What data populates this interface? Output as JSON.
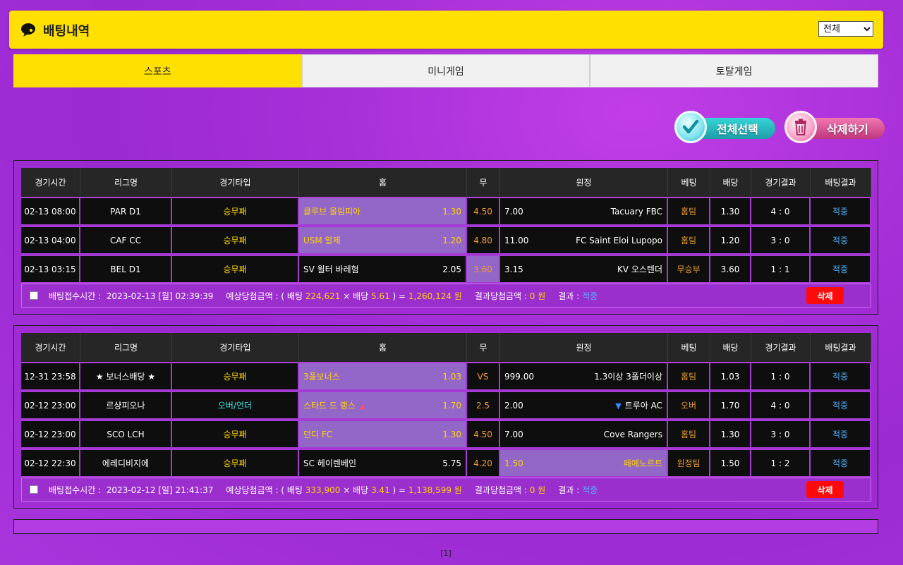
{
  "header": {
    "title": "배팅내역",
    "filter_selected": "전체"
  },
  "tabs": [
    {
      "label": "스포츠",
      "active": true
    },
    {
      "label": "미니게임",
      "active": false
    },
    {
      "label": "토탈게임",
      "active": false
    }
  ],
  "actions": {
    "select_all": "전체선택",
    "delete_all": "삭제하기"
  },
  "columns": [
    "경기시간",
    "리그명",
    "경기타입",
    "홈",
    "무",
    "원정",
    "베팅",
    "배당",
    "경기결과",
    "배팅결과"
  ],
  "bets": [
    {
      "rows": [
        {
          "time": "02-13 08:00",
          "league": "PAR D1",
          "type": "승무패",
          "home": "클루브 올림피아",
          "home_odds": "1.30",
          "draw": "4.50",
          "away_odds": "7.00",
          "away": "Tacuary FBC",
          "pick": "홈팀",
          "odds": "1.30",
          "score": "4 : 0",
          "result": "적중"
        },
        {
          "time": "02-13 04:00",
          "league": "CAF CC",
          "type": "승무패",
          "home": "USM 알제",
          "home_odds": "1.20",
          "draw": "4.80",
          "away_odds": "11.00",
          "away": "FC Saint Eloi Lupopo",
          "pick": "홈팀",
          "odds": "1.20",
          "score": "3 : 0",
          "result": "적중"
        },
        {
          "time": "02-13 03:15",
          "league": "BEL D1",
          "type": "승무패",
          "home": "SV 윌터 바레험",
          "home_odds": "2.05",
          "draw": "3.60",
          "away_odds": "3.15",
          "away": "KV 오스텐더",
          "pick": "무승부",
          "odds": "3.60",
          "score": "1 : 1",
          "result": "적중"
        }
      ],
      "footer": {
        "time_label": "배팅접수시간 :",
        "time_value": "2023-02-13 [월] 02:39:39",
        "expect_label": "예상당첨금액 : ( 배팅",
        "stake": "224,621",
        "times": "× 배당",
        "total_odds": "5.61",
        "eq": ") =",
        "payout": "1,260,124 원",
        "win_label": "결과당첨금액 :",
        "win_value": "0 원",
        "result_label": "결과 :",
        "result_value": "적중",
        "delete": "삭제"
      }
    },
    {
      "rows": [
        {
          "time": "12-31 23:58",
          "league": "★ 보너스배당 ★",
          "type": "승무패",
          "home": "3폴보너스",
          "home_odds": "1.03",
          "draw": "VS",
          "away_odds": "999.00",
          "away": "1.3이상 3폴더이상",
          "pick": "홈팀",
          "odds": "1.03",
          "score": "1 : 0",
          "result": "적중"
        },
        {
          "time": "02-12 23:00",
          "league": "르샹피오나",
          "type": "오버/언더",
          "home": "스타드 드 랭스",
          "home_odds": "1.70",
          "draw": "2.5",
          "away_odds": "2.00",
          "away": "트루아 AC",
          "pick": "오버",
          "odds": "1.70",
          "score": "4 : 0",
          "result": "적중"
        },
        {
          "time": "02-12 23:00",
          "league": "SCO LCH",
          "type": "승무패",
          "home": "던디 FC",
          "home_odds": "1.30",
          "draw": "4.50",
          "away_odds": "7.00",
          "away": "Cove Rangers",
          "pick": "홈팀",
          "odds": "1.30",
          "score": "3 : 0",
          "result": "적중"
        },
        {
          "time": "02-12 22:30",
          "league": "에레디비지에",
          "type": "승무패",
          "home": "SC 헤이렌베인",
          "home_odds": "5.75",
          "draw": "4.20",
          "away_odds": "1.50",
          "away": "페예노르트",
          "pick": "원정팀",
          "odds": "1.50",
          "score": "1 : 2",
          "result": "적중"
        }
      ],
      "footer": {
        "time_label": "배팅접수시간 :",
        "time_value": "2023-02-12 [일] 21:41:37",
        "expect_label": "예상당첨금액 : ( 배팅",
        "stake": "333,900",
        "times": "× 배당",
        "total_odds": "3.41",
        "eq": ") =",
        "payout": "1,138,599 원",
        "win_label": "결과당첨금액 :",
        "win_value": "0 원",
        "result_label": "결과 :",
        "result_value": "적중",
        "delete": "삭제"
      }
    }
  ],
  "pagination": "[1]",
  "colors": {
    "accent_yellow": "#ffe000",
    "selected_cell": "#9367c7",
    "delete_red": "#ff0a0a",
    "hit_blue": "#4fb3ff"
  }
}
